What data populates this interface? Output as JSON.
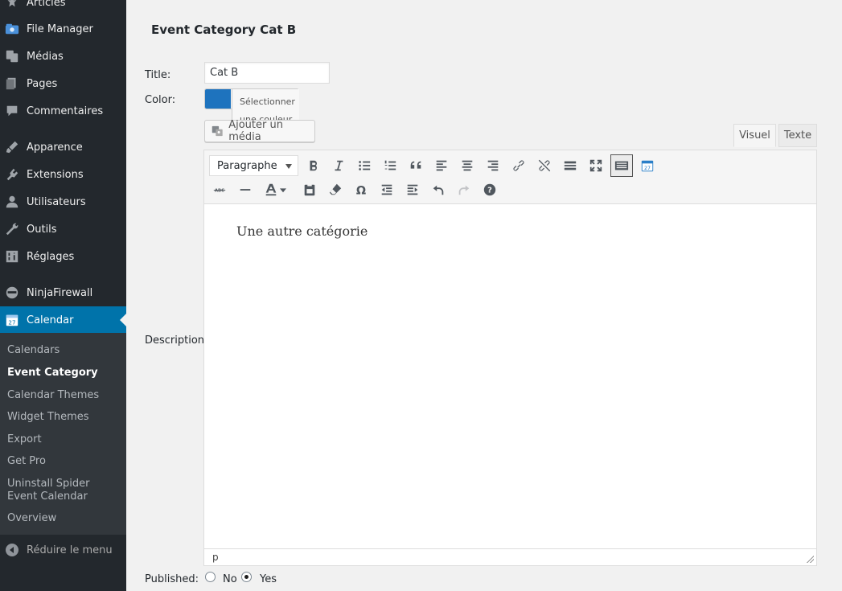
{
  "sidebar": {
    "items": [
      {
        "label": "Articles",
        "icon": "pin-icon"
      },
      {
        "label": "File Manager",
        "icon": "file-manager-icon"
      },
      {
        "label": "Médias",
        "icon": "media-icon"
      },
      {
        "label": "Pages",
        "icon": "pages-icon"
      },
      {
        "label": "Commentaires",
        "icon": "comments-icon"
      },
      {
        "label": "Apparence",
        "icon": "appearance-icon"
      },
      {
        "label": "Extensions",
        "icon": "plugins-icon"
      },
      {
        "label": "Utilisateurs",
        "icon": "users-icon"
      },
      {
        "label": "Outils",
        "icon": "tools-icon"
      },
      {
        "label": "Réglages",
        "icon": "settings-icon"
      },
      {
        "label": "NinjaFirewall",
        "icon": "ninja-icon"
      },
      {
        "label": "Calendar",
        "icon": "calendar-icon",
        "active": true
      }
    ],
    "submenu": [
      {
        "label": "Calendars"
      },
      {
        "label": "Event Category",
        "current": true
      },
      {
        "label": "Calendar Themes"
      },
      {
        "label": "Widget Themes"
      },
      {
        "label": "Export"
      },
      {
        "label": "Get Pro"
      },
      {
        "label": "Uninstall Spider Event Calendar"
      },
      {
        "label": "Overview"
      }
    ],
    "collapse_label": "Réduire le menu"
  },
  "page": {
    "title": "Event Category Cat B",
    "labels": {
      "title": "Title:",
      "color": "Color:",
      "description": "Description:",
      "published": "Published:"
    },
    "title_value": "Cat B",
    "color_button_text": "Sélectionner une couleur",
    "color_value": "#1e73be",
    "add_media_label": "Ajouter un média",
    "tabs": {
      "visual": "Visuel",
      "text": "Texte"
    },
    "format_select": "Paragraphe",
    "content": "Une autre catégorie",
    "statusbar_path": "p",
    "published": {
      "no_label": "No",
      "yes_label": "Yes",
      "selected": "Yes"
    }
  },
  "colors": {
    "sidebar_bg": "#23282d",
    "active": "#0073aa",
    "accent_calendar": "#2b7fc8"
  }
}
